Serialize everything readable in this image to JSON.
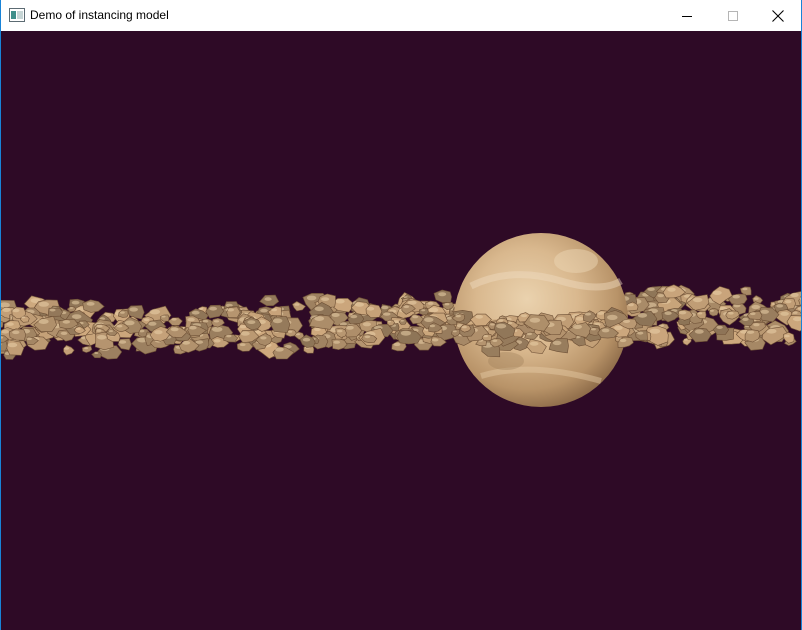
{
  "window": {
    "title": "Demo of instancing model",
    "icon": "app-window-icon",
    "controls": [
      "minimize-icon",
      "maximize-icon",
      "close-icon"
    ]
  },
  "scene": {
    "background_color": "#2e0a26",
    "planet_color": "#d6b48a",
    "asteroid_color": "#bc9a73",
    "content": [
      "planet",
      "asteroid-ring"
    ]
  }
}
